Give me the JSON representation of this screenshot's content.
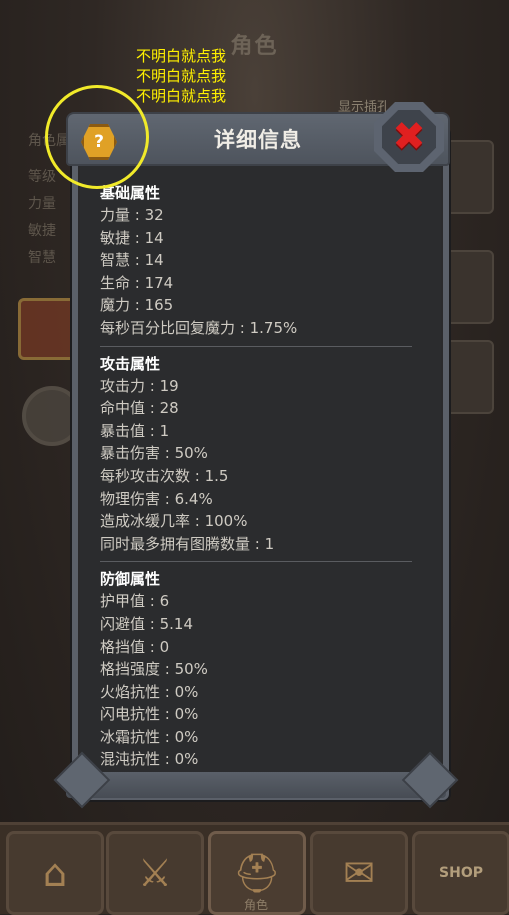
{
  "background": {
    "title": "角色",
    "show_slots": "显示插孔",
    "side_labels": [
      "角色属",
      "等级",
      "力量",
      "敏捷",
      "智慧"
    ]
  },
  "annotation": {
    "lines": [
      "不明白就点我",
      "不明白就点我",
      "不明白就点我"
    ]
  },
  "dialog": {
    "title": "详细信息",
    "help_label": "?",
    "close_label": "✖",
    "sections": [
      {
        "heading": "基础属性",
        "stats": [
          "力量 : 32",
          "敏捷 : 14",
          "智慧 : 14",
          "生命 : 174",
          "魔力 : 165",
          "每秒百分比回复魔力 : 1.75%"
        ]
      },
      {
        "heading": "攻击属性",
        "stats": [
          "攻击力 : 19",
          "命中值 : 28",
          "暴击值 : 1",
          "暴击伤害 : 50%",
          "每秒攻击次数 : 1.5",
          "物理伤害 : 6.4%",
          "造成冰缓几率 : 100%",
          "同时最多拥有图腾数量 : 1"
        ]
      },
      {
        "heading": "防御属性",
        "stats": [
          "护甲值 : 6",
          "闪避值 : 5.14",
          "格挡值 : 0",
          "格挡强度 : 50%",
          "火焰抗性 : 0%",
          "闪电抗性 : 0%",
          "冰霜抗性 : 0%",
          "混沌抗性 : 0%"
        ]
      }
    ]
  },
  "nav": {
    "items": [
      {
        "name": "home-icon",
        "glyph": "⌂"
      },
      {
        "name": "sword-shield-icon",
        "glyph": "⚔"
      },
      {
        "name": "helmet-icon",
        "glyph": "⛑"
      },
      {
        "name": "scroll-icon",
        "glyph": "✉"
      },
      {
        "name": "shop-icon",
        "glyph": "SHOP"
      }
    ],
    "active_label": "角色"
  },
  "colors": {
    "annotation": "#fff000",
    "help_button": "#e0a126",
    "close_x": "#e02020",
    "panel_bg": "#2b2c2e"
  }
}
